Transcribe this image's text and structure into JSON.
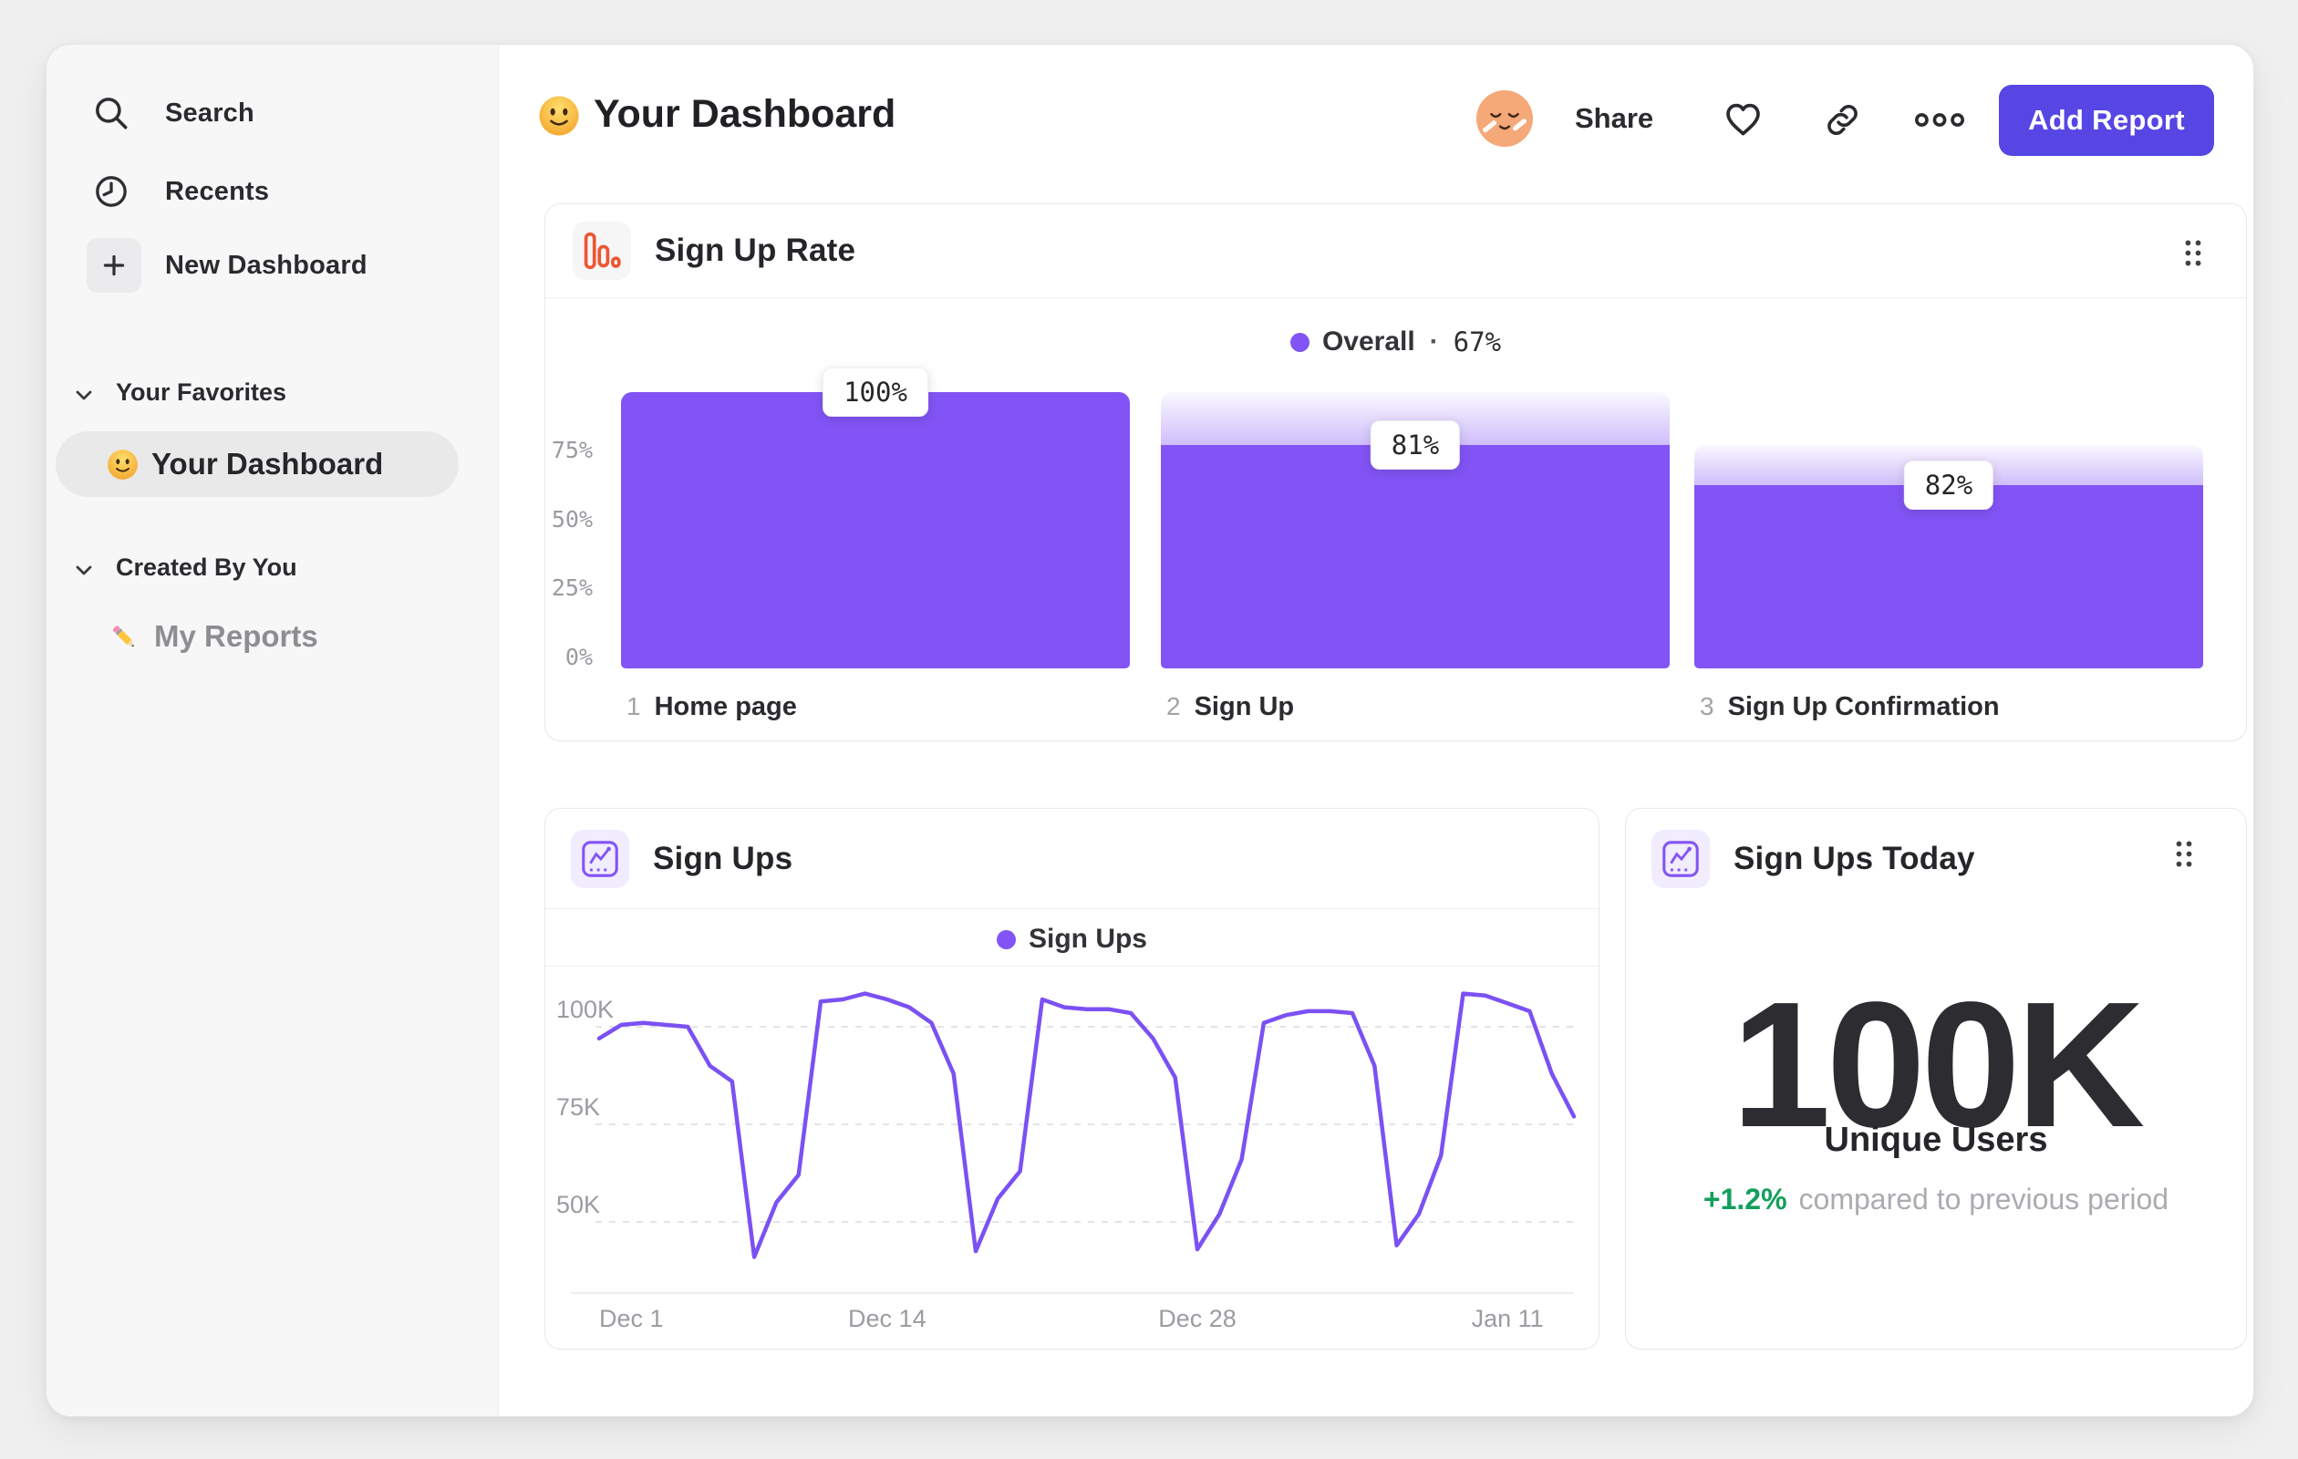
{
  "app": {
    "accent": "#8254F5",
    "button_color": "#5646E4",
    "positive_color": "#129E5C"
  },
  "sidebar": {
    "items": [
      {
        "label": "Search",
        "icon": "search-icon"
      },
      {
        "label": "Recents",
        "icon": "clock-icon"
      },
      {
        "label": "New Dashboard",
        "icon": "plus-icon"
      }
    ],
    "sections": [
      {
        "title": "Your Favorites",
        "items": [
          {
            "label": "Your Dashboard",
            "icon": "smiley-emoji",
            "active": true
          }
        ]
      },
      {
        "title": "Created By You",
        "items": [
          {
            "label": "My Reports",
            "icon": "pencil-emoji",
            "active": false
          }
        ]
      }
    ]
  },
  "header": {
    "title": "Your Dashboard",
    "emoji": "smiley-emoji",
    "share_label": "Share",
    "add_report_label": "Add Report",
    "icons": [
      "avatar",
      "heart-icon",
      "link-icon",
      "more-icon"
    ]
  },
  "cards": {
    "signups_today": {
      "title": "Sign Ups Today",
      "value": "100K",
      "unit_label": "Unique Users",
      "change": "+1.2%",
      "change_note": "compared to previous period"
    }
  },
  "chart_data": [
    {
      "type": "bar",
      "variant": "funnel",
      "title": "Sign Up Rate",
      "legend": {
        "label": "Overall",
        "separator": "·",
        "value_label": "67%"
      },
      "bar_color": "#8254F5",
      "y_ticks": [
        {
          "pct": 75,
          "label": "75%"
        },
        {
          "pct": 50,
          "label": "50%"
        },
        {
          "pct": 25,
          "label": "25%"
        },
        {
          "pct": 0,
          "label": "0%"
        }
      ],
      "steps": [
        {
          "step": "1",
          "name": "Home page",
          "conversion_label": "100%",
          "cumulative_pct": 100,
          "previous_pct": 100
        },
        {
          "step": "2",
          "name": "Sign Up",
          "conversion_label": "81%",
          "cumulative_pct": 81,
          "previous_pct": 100
        },
        {
          "step": "3",
          "name": "Sign Up Confirmation",
          "conversion_label": "82%",
          "cumulative_pct": 66.4,
          "previous_pct": 81
        }
      ]
    },
    {
      "type": "line",
      "title": "Sign Ups",
      "line_color": "#7B51F3",
      "unit": "K",
      "ylim": [
        31,
        112
      ],
      "grid": "dashed-horizontal",
      "legend_position": "top-center",
      "y_gridlines": [
        {
          "value": 100,
          "label": "100K"
        },
        {
          "value": 75,
          "label": "75K"
        },
        {
          "value": 50,
          "label": "50K"
        }
      ],
      "x_ticks": [
        {
          "index": 0,
          "label": "Dec 1"
        },
        {
          "index": 13,
          "label": "Dec 14"
        },
        {
          "index": 27,
          "label": "Dec 28"
        },
        {
          "index": 41,
          "label": "Jan 11"
        }
      ],
      "series": [
        {
          "name": "Sign Ups",
          "values": [
            97,
            100.5,
            101,
            100.5,
            100,
            90,
            86,
            41,
            55,
            62,
            106.5,
            107,
            108.5,
            107,
            105,
            101,
            88,
            42.5,
            56,
            63,
            107,
            105,
            104.5,
            104.5,
            103.5,
            97,
            87,
            43,
            52,
            66,
            101,
            103,
            104,
            104,
            103.5,
            90,
            44,
            52,
            67,
            108.5,
            108,
            106,
            104,
            88,
            77
          ]
        }
      ]
    }
  ]
}
